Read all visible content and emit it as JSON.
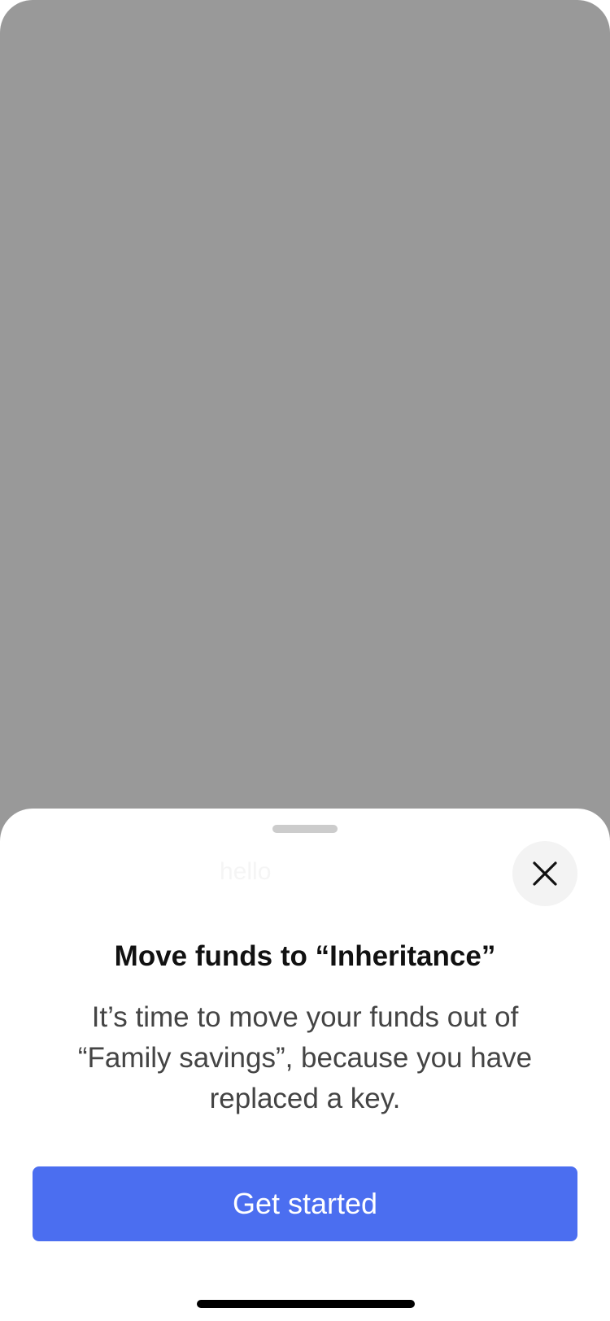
{
  "background": {
    "overlay_color": "#999999"
  },
  "sheet": {
    "ghost_label": "hello",
    "close_icon": "close-icon",
    "title": "Move funds to “Inheritance”",
    "body": "It’s time to move your funds out of “Family savings”, because you have replaced a key.",
    "primary_button_label": "Get started",
    "accent_color": "#4b6ef0"
  }
}
